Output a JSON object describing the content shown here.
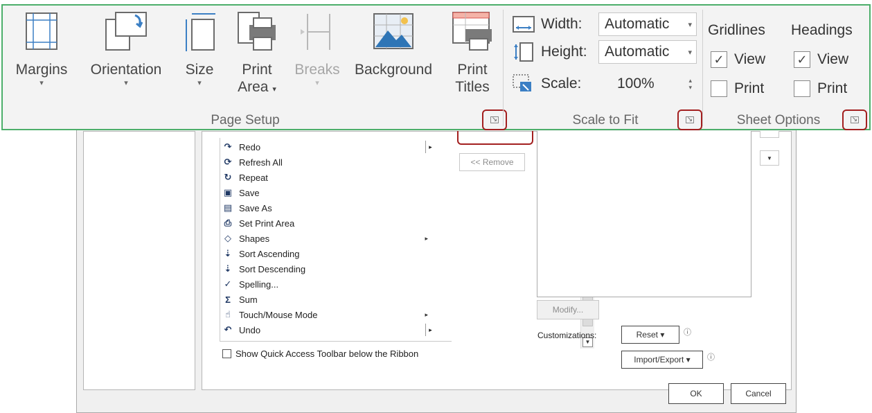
{
  "ribbon": {
    "page_setup": {
      "label": "Page Setup",
      "margins": {
        "l1": "Margins"
      },
      "orientation": {
        "l1": "Orientation"
      },
      "size": {
        "l1": "Size"
      },
      "print_area": {
        "l1": "Print",
        "l2": "Area"
      },
      "breaks": {
        "l1": "Breaks"
      },
      "background": {
        "l1": "Background"
      },
      "print_titles": {
        "l1": "Print",
        "l2": "Titles"
      }
    },
    "scale_to_fit": {
      "label": "Scale to Fit",
      "width_label": "Width:",
      "width_value": "Automatic",
      "height_label": "Height:",
      "height_value": "Automatic",
      "scale_label": "Scale:",
      "scale_value": "100%"
    },
    "sheet_options": {
      "label": "Sheet Options",
      "gridlines_label": "Gridlines",
      "headings_label": "Headings",
      "view_label": "View",
      "print_label": "Print",
      "gridlines_view": true,
      "gridlines_print": false,
      "headings_view": true,
      "headings_print": false
    }
  },
  "dialog": {
    "commands": [
      {
        "icon": "redo-icon",
        "label": "Redo",
        "submenu": "split"
      },
      {
        "icon": "refresh-all-icon",
        "label": "Refresh All"
      },
      {
        "icon": "repeat-icon",
        "label": "Repeat"
      },
      {
        "icon": "save-icon",
        "label": "Save"
      },
      {
        "icon": "save-as-icon",
        "label": "Save As"
      },
      {
        "icon": "set-print-area-icon",
        "label": "Set Print Area"
      },
      {
        "icon": "shapes-icon",
        "label": "Shapes",
        "submenu": "arrow"
      },
      {
        "icon": "sort-ascending-icon",
        "label": "Sort Ascending"
      },
      {
        "icon": "sort-descending-icon",
        "label": "Sort Descending"
      },
      {
        "icon": "spelling-icon",
        "label": "Spelling..."
      },
      {
        "icon": "sum-icon",
        "label": "Sum"
      },
      {
        "icon": "touch-mouse-icon",
        "label": "Touch/Mouse Mode",
        "submenu": "arrow"
      },
      {
        "icon": "undo-icon",
        "label": "Undo",
        "submenu": "split"
      }
    ],
    "show_qat_label": "Show Quick Access Toolbar below the Ribbon",
    "remove_label": "<< Remove",
    "modify_label": "Modify...",
    "customizations_label": "Customizations:",
    "reset_label": "Reset ▾",
    "import_export_label": "Import/Export ▾",
    "ok_label": "OK",
    "cancel_label": "Cancel"
  },
  "colors": {
    "ribbon_border": "#4cae6a",
    "highlight": "#a31f1f"
  }
}
